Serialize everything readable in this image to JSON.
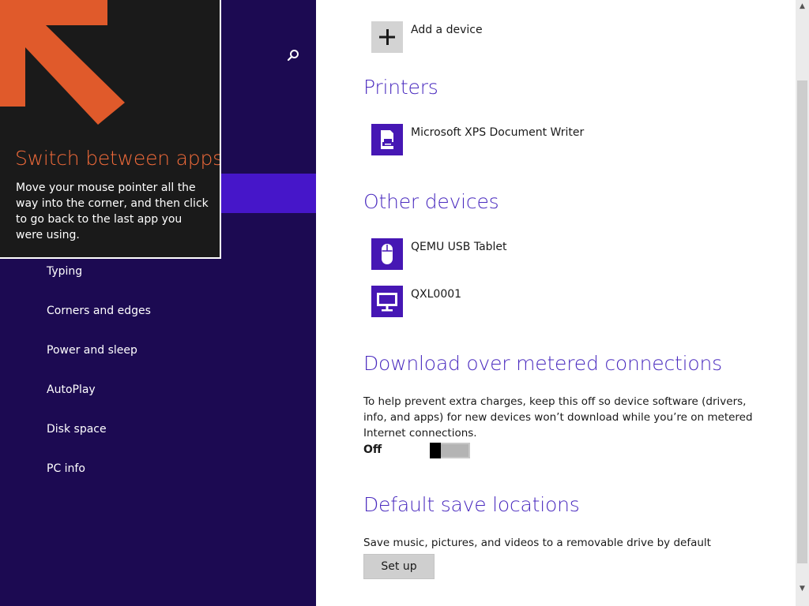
{
  "tip": {
    "title": "Switch between apps",
    "body": "Move your mouse pointer all the way into the corner, and then click to go back to the last app you were using.",
    "accent_color": "#f26b3a"
  },
  "search": {
    "icon": "search-icon"
  },
  "nav": {
    "items": [
      {
        "label": "Typing"
      },
      {
        "label": "Corners and edges"
      },
      {
        "label": "Power and sleep"
      },
      {
        "label": "AutoPlay"
      },
      {
        "label": "Disk space"
      },
      {
        "label": "PC info"
      }
    ],
    "selected_color": "#4616c9",
    "background_color": "#1c0a52"
  },
  "devices": {
    "add_label": "Add a device",
    "printers_heading": "Printers",
    "printers": [
      {
        "label": "Microsoft XPS Document Writer",
        "icon": "printer-icon"
      }
    ],
    "other_heading": "Other devices",
    "other": [
      {
        "label": "QEMU USB Tablet",
        "icon": "mouse-icon"
      },
      {
        "label": "QXL0001",
        "icon": "monitor-icon"
      }
    ]
  },
  "metered": {
    "heading": "Download over metered connections",
    "description": "To help prevent extra charges, keep this off so device software (drivers, info, and apps) for new devices won’t download while you’re on metered Internet connections.",
    "toggle_state": "Off",
    "toggle_on": false
  },
  "save_locations": {
    "heading": "Default save locations",
    "description": "Save music, pictures, and videos to a removable drive by default",
    "button_label": "Set up"
  },
  "colors": {
    "heading": "#4a2bbf",
    "tile": "#4617b4"
  }
}
